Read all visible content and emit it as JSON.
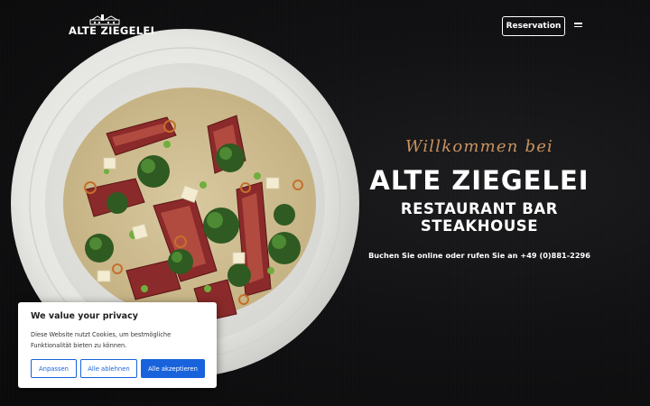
{
  "header": {
    "logo_text": "ALTE ZIEGELEI",
    "reservation_label": "Reservation"
  },
  "hero": {
    "welcome": "Willkommen bei",
    "title": "ALTE ZIEGELEI",
    "subtitle_line1": "RESTAURANT BAR",
    "subtitle_line2": "STEAKHOUSE",
    "contact": "Buchen Sie online oder rufen Sie an +49 (0)881-2296"
  },
  "cookie_banner": {
    "title": "We value your privacy",
    "text": "Diese Website nutzt Cookies, um bestmögliche Funktionalität bieten zu können.",
    "customize_label": "Anpassen",
    "reject_label": "Alle ablehnen",
    "accept_label": "Alle akzeptieren"
  },
  "colors": {
    "background": "#0c0c0d",
    "accent_script": "#c9935f",
    "cookie_button_blue": "#1863dc"
  },
  "icons": {
    "menu": "hamburger-menu-icon",
    "logo": "brick-factory-logo"
  }
}
